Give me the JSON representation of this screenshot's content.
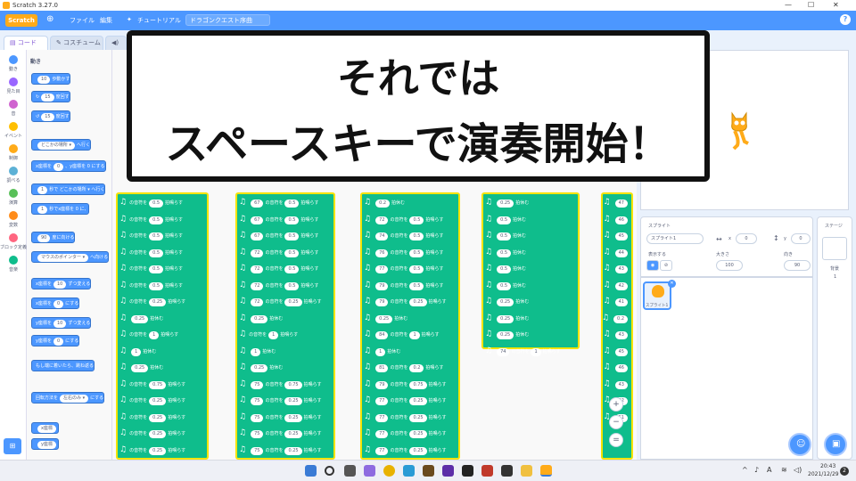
{
  "window": {
    "title": "Scratch 3.27.0",
    "minimize": "—",
    "maximize": "☐",
    "close": "✕"
  },
  "menubar": {
    "logo": "Scratch",
    "file": "ファイル",
    "edit": "編集",
    "tutorial": "チュートリアル",
    "project_title": "ドラゴンクエスト序曲"
  },
  "tabs": {
    "code": "コード",
    "costume": "コスチューム"
  },
  "categories": [
    {
      "label": "動き",
      "color": "#4c97ff"
    },
    {
      "label": "見た目",
      "color": "#9966ff"
    },
    {
      "label": "音",
      "color": "#cf63cf"
    },
    {
      "label": "イベント",
      "color": "#ffbf00"
    },
    {
      "label": "制御",
      "color": "#ffab19"
    },
    {
      "label": "調べる",
      "color": "#5cb1d6"
    },
    {
      "label": "演算",
      "color": "#59c059"
    },
    {
      "label": "変数",
      "color": "#ff8c1a"
    },
    {
      "label": "ブロック定義",
      "color": "#ff6680"
    },
    {
      "label": "音楽",
      "color": "#0fbd8c"
    }
  ],
  "palette": {
    "heading": "動き",
    "blocks": [
      {
        "pre": "",
        "val": "10",
        "post": "歩動かす"
      },
      {
        "pre": "↻",
        "val": "15",
        "post": "度回す"
      },
      {
        "pre": "↺",
        "val": "15",
        "post": "度回す"
      },
      {
        "pre": "",
        "val": "どこかの場所 ▾",
        "post": "へ行く"
      },
      {
        "pre": "x座標を",
        "val": "0",
        "post": "、y座標を 0 にする"
      },
      {
        "pre": "",
        "val": "1",
        "post": "秒で どこかの場所 ▾ へ行く"
      },
      {
        "pre": "",
        "val": "1",
        "post": "秒でx座標を 0 に、"
      },
      {
        "pre": "",
        "val": "90",
        "post": "度に向ける"
      },
      {
        "pre": "",
        "val": "マウスのポインター ▾",
        "post": "へ向ける"
      },
      {
        "pre": "x座標を",
        "val": "10",
        "post": "ずつ変える"
      },
      {
        "pre": "x座標を",
        "val": "0",
        "post": "にする"
      },
      {
        "pre": "y座標を",
        "val": "10",
        "post": "ずつ変える"
      },
      {
        "pre": "y座標を",
        "val": "0",
        "post": "にする"
      },
      {
        "pre": "もし端に着いたら、跳ね返る",
        "val": "",
        "post": ""
      },
      {
        "pre": "回転方法を",
        "val": "左右のみ ▾",
        "post": "にする"
      },
      {
        "pre": "",
        "val": "x座標",
        "post": ""
      },
      {
        "pre": "",
        "val": "y座標",
        "post": ""
      }
    ]
  },
  "script": {
    "note_label": "の音符を",
    "beats_label": "拍鳴らす",
    "rest_label": "拍休む",
    "col1": [
      [
        "",
        "0.5"
      ],
      [
        "",
        "0.5"
      ],
      [
        "",
        "0.5"
      ],
      [
        "",
        "0.5"
      ],
      [
        "",
        "0.5"
      ],
      [
        "",
        "0.5"
      ],
      [
        "",
        "0.25"
      ],
      [
        "rest",
        "0.25"
      ],
      [
        "",
        "1"
      ],
      [
        "rest",
        "1"
      ],
      [
        "rest",
        "0.25"
      ],
      [
        "",
        "0.75"
      ],
      [
        "",
        "0.25"
      ],
      [
        "",
        "0.25"
      ],
      [
        "",
        "0.25"
      ],
      [
        "",
        "0.25"
      ]
    ],
    "col2": [
      [
        "67",
        "0.5"
      ],
      [
        "67",
        "0.5"
      ],
      [
        "67",
        "0.5"
      ],
      [
        "72",
        "0.5"
      ],
      [
        "72",
        "0.5"
      ],
      [
        "72",
        "0.5"
      ],
      [
        "72",
        "0.25"
      ],
      [
        "rest",
        "0.25"
      ],
      [
        "",
        "1"
      ],
      [
        "rest",
        "1"
      ],
      [
        "rest",
        "0.25"
      ],
      [
        "75",
        "0.75"
      ],
      [
        "75",
        "0.25"
      ],
      [
        "75",
        "0.25"
      ],
      [
        "75",
        "0.25"
      ],
      [
        "75",
        "0.25"
      ]
    ],
    "col3": [
      [
        "rest",
        "0.2"
      ],
      [
        "72",
        "0.5"
      ],
      [
        "74",
        "0.5"
      ],
      [
        "76",
        "0.5"
      ],
      [
        "77",
        "0.5"
      ],
      [
        "79",
        "0.5"
      ],
      [
        "79",
        "0.25"
      ],
      [
        "rest",
        "0.25"
      ],
      [
        "84",
        "1"
      ],
      [
        "rest",
        "1"
      ],
      [
        "81",
        "0.2"
      ],
      [
        "79",
        "0.75"
      ],
      [
        "77",
        "0.25"
      ],
      [
        "77",
        "0.25"
      ],
      [
        "77",
        "0.25"
      ],
      [
        "77",
        "0.25"
      ]
    ],
    "col4": [
      [
        "rest",
        "0.25"
      ],
      [
        "rest",
        "0.5"
      ],
      [
        "rest",
        "0.5"
      ],
      [
        "rest",
        "0.5"
      ],
      [
        "rest",
        "0.5"
      ],
      [
        "rest",
        "0.5"
      ],
      [
        "rest",
        "0.25"
      ],
      [
        "rest",
        "0.25"
      ],
      [
        "rest",
        "0.25"
      ],
      [
        "74",
        "1"
      ]
    ],
    "col5": [
      "47",
      "46",
      "45",
      "44",
      "43",
      "42",
      "41",
      "0.2",
      "43",
      "45",
      "46",
      "43",
      "52",
      "51"
    ]
  },
  "banner": {
    "line1": "それでは",
    "line2": "スペースキーで演奏開始！"
  },
  "sprite": {
    "label": "スプライト",
    "name": "スプライト1",
    "x_label": "x",
    "x": "0",
    "y_label": "y",
    "y": "0",
    "show_label": "表示する",
    "size_label": "大きさ",
    "size": "100",
    "direction_label": "向き",
    "direction": "90",
    "thumb_label": "スプライト1"
  },
  "stage_col": {
    "label": "ステージ",
    "bg_label": "背景",
    "bg_count": "1"
  },
  "taskbar": {
    "time": "20:43",
    "date": "2021/12/29",
    "notify": "2"
  },
  "colors": {
    "accent": "#4c97ff",
    "music": "#0fbd8c",
    "glow": "#f4e300"
  }
}
